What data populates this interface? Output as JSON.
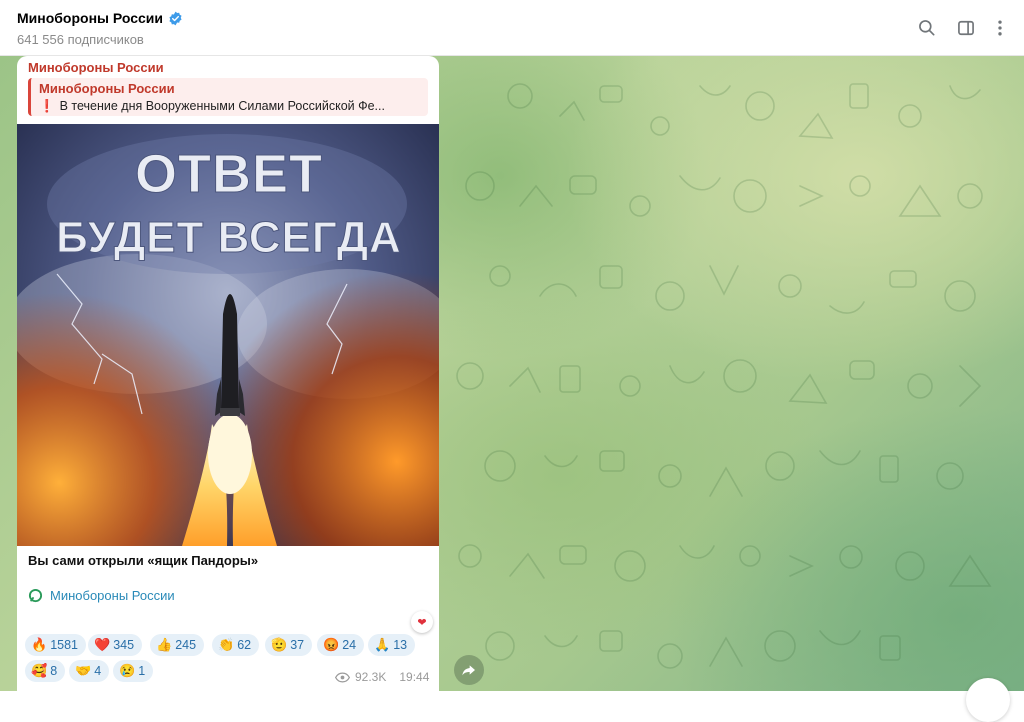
{
  "header": {
    "title": "Минобороны России",
    "subscribers": "641 556 подписчиков",
    "verified_icon": "verified-badge-icon",
    "actions": [
      "search-icon",
      "sidebar-toggle-icon",
      "more-vertical-icon"
    ]
  },
  "message": {
    "author": "Минобороны России",
    "reply": {
      "title": "Минобороны России",
      "mark": "❗",
      "text": "В течение дня Вооруженными Силами Российской Фе..."
    },
    "image": {
      "headline_line1": "ОТВЕТ",
      "headline_line2": "БУДЕТ ВСЕГДА"
    },
    "caption": "Вы сами открыли «ящик Пандоры»",
    "signature": "Минобороны России",
    "reactions": [
      {
        "emoji": "🔥",
        "count": "1581"
      },
      {
        "emoji": "❤️",
        "count": "345"
      },
      {
        "emoji": "👍",
        "count": "245"
      },
      {
        "emoji": "👏",
        "count": "62"
      },
      {
        "emoji": "🫡",
        "count": "37"
      },
      {
        "emoji": "😡",
        "count": "24"
      },
      {
        "emoji": "🙏",
        "count": "13"
      },
      {
        "emoji": "🥰",
        "count": "8"
      },
      {
        "emoji": "🤝",
        "count": "4"
      },
      {
        "emoji": "😢",
        "count": "1"
      }
    ],
    "views": "92.3K",
    "time": "19:44",
    "my_reaction": "❤"
  },
  "colors": {
    "accent": "#2a8ab8",
    "author": "#c0392b",
    "reaction_bg": "#e6f0f8"
  }
}
